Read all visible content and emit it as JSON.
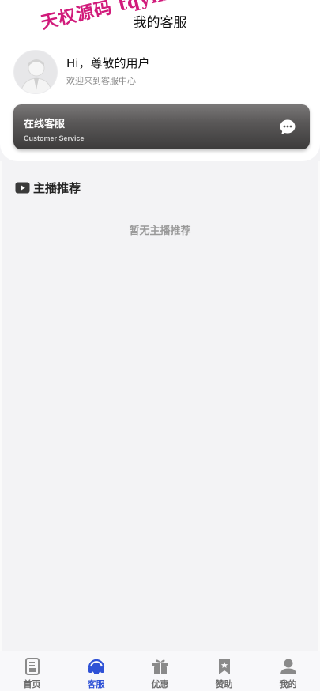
{
  "header": {
    "watermark": "天权源码 tqym",
    "title": "我的客服"
  },
  "profile": {
    "greeting": "Hi，尊敬的用户",
    "welcome": "欢迎来到客服中心"
  },
  "service_card": {
    "title": "在线客服",
    "subtitle": "Customer Service",
    "icon": "chat-bubble-icon"
  },
  "section": {
    "icon": "video-play-icon",
    "title": "主播推荐",
    "empty_text": "暂无主播推荐"
  },
  "tabbar": {
    "active_color": "#2f52d6",
    "inactive_color": "#8a8a8a",
    "tabs": [
      {
        "label": "首页",
        "icon": "home-doc-icon",
        "active": false
      },
      {
        "label": "客服",
        "icon": "headset-icon",
        "active": true
      },
      {
        "label": "优惠",
        "icon": "gift-icon",
        "active": false
      },
      {
        "label": "赞助",
        "icon": "bookmark-star-icon",
        "active": false
      },
      {
        "label": "我的",
        "icon": "user-icon",
        "active": false
      }
    ]
  }
}
